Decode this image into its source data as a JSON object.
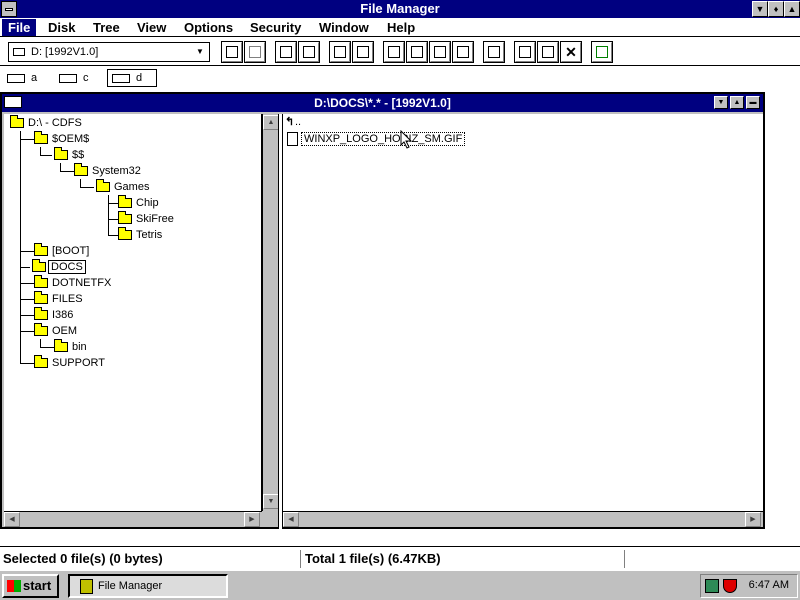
{
  "app": {
    "title": "File Manager"
  },
  "menu": [
    "File",
    "Disk",
    "Tree",
    "View",
    "Options",
    "Security",
    "Window",
    "Help"
  ],
  "toolbar": {
    "drive_select": "D: [1992V1.0]"
  },
  "drives": [
    "a",
    "c",
    "d"
  ],
  "child_window": {
    "title": "D:\\DOCS\\*.* - [1992V1.0]"
  },
  "tree": [
    {
      "label": "D:\\ - CDFS"
    },
    {
      "label": "$OEM$"
    },
    {
      "label": "$$"
    },
    {
      "label": "System32"
    },
    {
      "label": "Games"
    },
    {
      "label": "Chip"
    },
    {
      "label": "SkiFree"
    },
    {
      "label": "Tetris"
    },
    {
      "label": "[BOOT]"
    },
    {
      "label": "DOCS"
    },
    {
      "label": "DOTNETFX"
    },
    {
      "label": "FILES"
    },
    {
      "label": "I386"
    },
    {
      "label": "OEM"
    },
    {
      "label": "bin"
    },
    {
      "label": "SUPPORT"
    }
  ],
  "files": [
    {
      "name": ".."
    },
    {
      "name": "WINXP_LOGO_HORIZ_SM.GIF"
    }
  ],
  "status": {
    "selected": "Selected 0 file(s) (0 bytes)",
    "total": "Total 1 file(s) (6.47KB)"
  },
  "taskbar": {
    "start": "start",
    "task": "File Manager",
    "clock": "6:47 AM",
    "tray_icons": [
      "network-icon",
      "shield-icon"
    ]
  },
  "colors": {
    "title_bar": "#000080",
    "folder": "#ffff00",
    "window_bg": "#c0c0c0"
  }
}
